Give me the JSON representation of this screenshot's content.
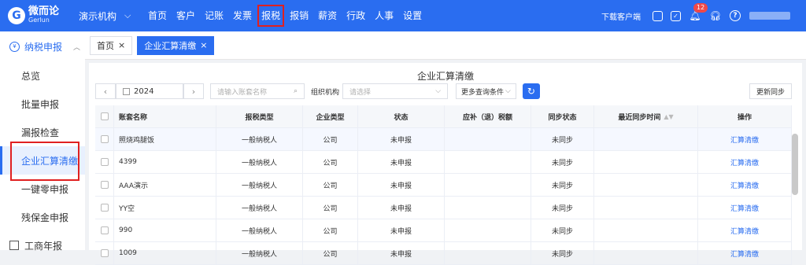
{
  "brand": {
    "logo_glyph": "G",
    "name_cn": "微而论",
    "name_en": "Gerlun",
    "color": "#2a6df0"
  },
  "org_selector": {
    "label": "演示机构",
    "chevron_icon": "chevron-down-icon"
  },
  "nav": [
    {
      "label": "首页"
    },
    {
      "label": "客户"
    },
    {
      "label": "记账"
    },
    {
      "label": "发票"
    },
    {
      "label": "报税"
    },
    {
      "label": "报销"
    },
    {
      "label": "薪资"
    },
    {
      "label": "行政"
    },
    {
      "label": "人事"
    },
    {
      "label": "设置"
    }
  ],
  "topbar_right": {
    "download": "下载客户端",
    "notification_count": "12",
    "help": "?"
  },
  "sidebar": {
    "section": "纳税申报",
    "items": [
      {
        "label": "总览"
      },
      {
        "label": "批量申报"
      },
      {
        "label": "漏报检查"
      },
      {
        "label": "企业汇算清缴"
      },
      {
        "label": "一键零申报"
      },
      {
        "label": "残保金申报"
      }
    ],
    "bottom": "工商年报"
  },
  "tabs": [
    {
      "label": "首页",
      "close": "×"
    },
    {
      "label": "企业汇算清缴",
      "close": "×"
    }
  ],
  "page": {
    "title": "企业汇算清缴",
    "year": "2024",
    "prev": "‹",
    "next": "›",
    "search_placeholder": "请输入账套名称",
    "org_label": "组织机构",
    "org_placeholder": "请选择",
    "more_filters": "更多查询条件",
    "sync_button": "更新同步"
  },
  "table": {
    "headers": [
      "账套名称",
      "报税类型",
      "企业类型",
      "状态",
      "应补（退）税额",
      "同步状态",
      "最近同步时间",
      "操作"
    ],
    "rows": [
      {
        "name": "照烧鸡腿饭",
        "tax_type": "一般纳税人",
        "company_type": "公司",
        "status": "未申报",
        "amount": "",
        "sync": "未同步",
        "time": "",
        "action": "汇算清缴"
      },
      {
        "name": "4399",
        "tax_type": "一般纳税人",
        "company_type": "公司",
        "status": "未申报",
        "amount": "",
        "sync": "未同步",
        "time": "",
        "action": "汇算清缴"
      },
      {
        "name": "AAA演示",
        "tax_type": "一般纳税人",
        "company_type": "公司",
        "status": "未申报",
        "amount": "",
        "sync": "未同步",
        "time": "",
        "action": "汇算清缴"
      },
      {
        "name": "YY空",
        "tax_type": "一般纳税人",
        "company_type": "公司",
        "status": "未申报",
        "amount": "",
        "sync": "未同步",
        "time": "",
        "action": "汇算清缴"
      },
      {
        "name": "990",
        "tax_type": "一般纳税人",
        "company_type": "公司",
        "status": "未申报",
        "amount": "",
        "sync": "未同步",
        "time": "",
        "action": "汇算清缴"
      },
      {
        "name": "1009",
        "tax_type": "一般纳税人",
        "company_type": "公司",
        "status": "未申报",
        "amount": "",
        "sync": "未同步",
        "time": "",
        "action": "汇算清缴"
      }
    ]
  }
}
